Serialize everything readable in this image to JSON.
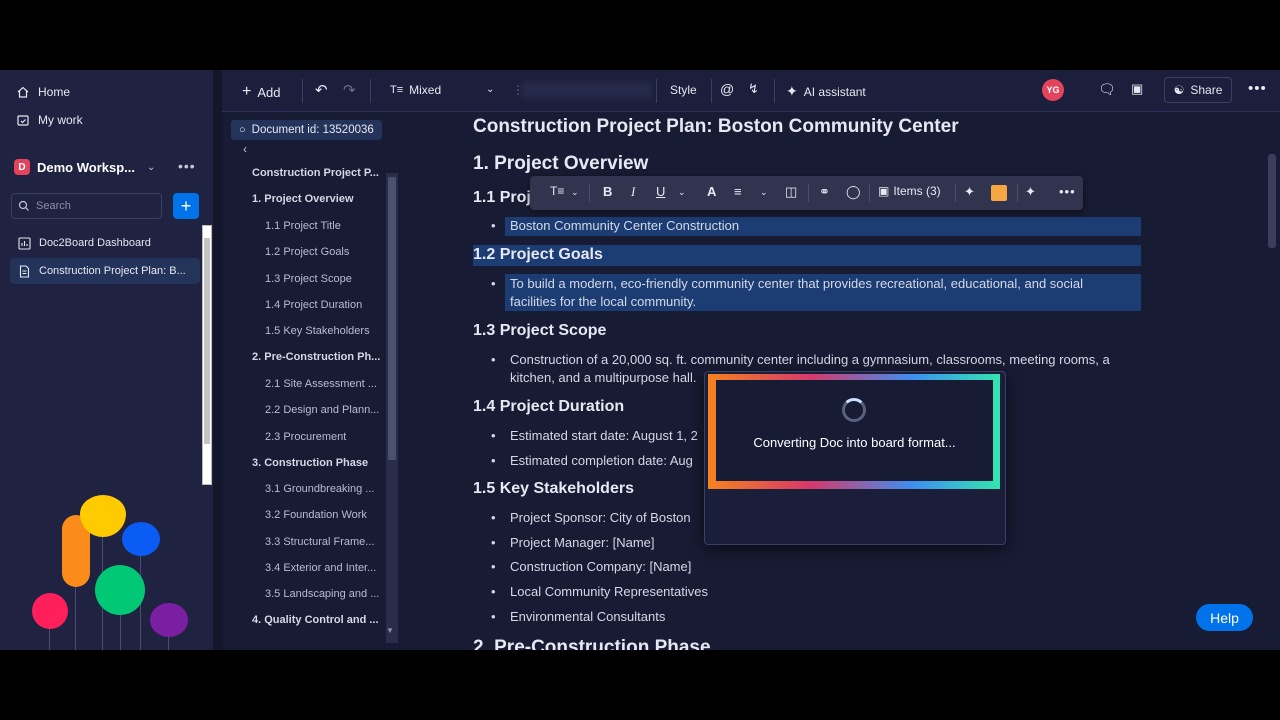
{
  "sidebar": {
    "home": "Home",
    "my_work": "My work",
    "workspace_initial": "D",
    "workspace_name": "Demo Worksp...",
    "search_placeholder": "Search",
    "boards": [
      "Doc2Board Dashboard",
      "Construction Project Plan: B..."
    ]
  },
  "toolbar": {
    "add": "Add",
    "mixed": "Mixed",
    "style": "Style",
    "ai_assistant": "AI assistant",
    "avatar": "YG",
    "share": "Share"
  },
  "toc": {
    "doc_id": "Document id: 13520036",
    "items": [
      {
        "label": "Construction Project P...",
        "level": 0
      },
      {
        "label": "1. Project Overview",
        "level": 1
      },
      {
        "label": "1.1 Project Title",
        "level": 2
      },
      {
        "label": "1.2 Project Goals",
        "level": 2
      },
      {
        "label": "1.3 Project Scope",
        "level": 2
      },
      {
        "label": "1.4 Project Duration",
        "level": 2
      },
      {
        "label": "1.5 Key Stakeholders",
        "level": 2
      },
      {
        "label": "2. Pre-Construction Ph...",
        "level": 1
      },
      {
        "label": "2.1 Site Assessment ...",
        "level": 2
      },
      {
        "label": "2.2 Design and Plann...",
        "level": 2
      },
      {
        "label": "2.3 Procurement",
        "level": 2
      },
      {
        "label": "3. Construction Phase",
        "level": 1
      },
      {
        "label": "3.1 Groundbreaking ...",
        "level": 2
      },
      {
        "label": "3.2 Foundation Work",
        "level": 2
      },
      {
        "label": "3.3 Structural Frame...",
        "level": 2
      },
      {
        "label": "3.4 Exterior and Inter...",
        "level": 2
      },
      {
        "label": "3.5 Landscaping and ...",
        "level": 2
      },
      {
        "label": "4. Quality Control and ...",
        "level": 1
      }
    ]
  },
  "doc": {
    "title": "Construction Project Plan: Boston Community Center",
    "h_overview": "1. Project Overview",
    "h_title": "1.1 Proje",
    "title_bullet": "Boston Community Center Construction",
    "h_goals": "1.2 Project Goals",
    "goals_line1": "To build a modern, eco-friendly community center that provides recreational, educational, and social",
    "goals_line2": "facilities for the local community.",
    "h_scope": "1.3 Project Scope",
    "scope_line1": "Construction of a 20,000 sq. ft. community center including a gymnasium, classrooms, meeting rooms, a",
    "scope_line2": "kitchen, and a multipurpose hall.",
    "h_duration": "1.4 Project Duration",
    "start": "Estimated start date: August 1, 2",
    "completion": "Estimated completion date: Aug",
    "h_stakeholders": "1.5 Key Stakeholders",
    "stakeholders": [
      "Project Sponsor: City of Boston",
      "Project Manager: [Name]",
      "Construction Company: [Name]",
      "Local Community Representatives",
      "Environmental Consultants"
    ],
    "h_preconstruction": "2. Pre-Construction Phase"
  },
  "format_toolbar": {
    "items_label": "Items (3)"
  },
  "modal": {
    "text": "Converting Doc into board format..."
  },
  "help": "Help",
  "colors": {
    "accent": "#0073ea",
    "selection": "#1c3d74",
    "background": "#181b34"
  }
}
